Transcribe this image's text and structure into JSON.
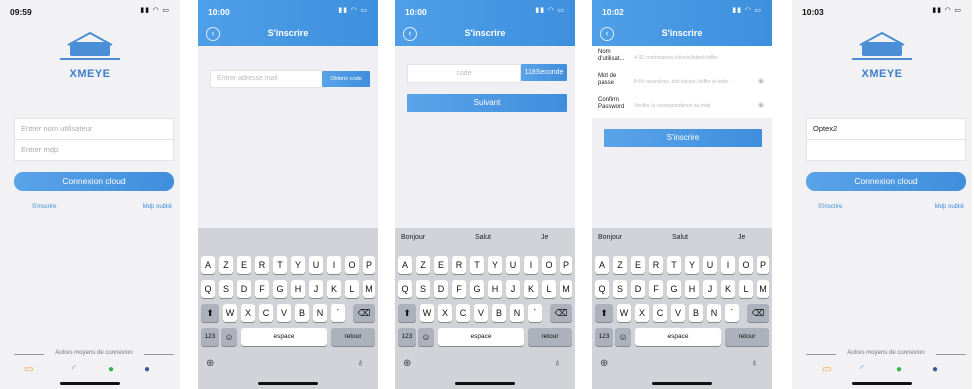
{
  "login": {
    "time": "09:59",
    "logo_text": "XMEYE",
    "username_placeholder": "Entrer nom utilisateur",
    "password_placeholder": "Entrer mdp",
    "cloud_button": "Connexion cloud",
    "register_link": "S'inscrire",
    "forgot_link": "Mdp oublié",
    "other_methods": "Autres moyens de connexion"
  },
  "email": {
    "time": "10:00",
    "title": "S'inscrire",
    "email_placeholder": "Entrer adresse mail",
    "code_button": "Obtenir code"
  },
  "code": {
    "time": "10:00",
    "title": "S'inscrire",
    "code_placeholder": "code",
    "countdown": "118Seconde",
    "next_button": "Suivant"
  },
  "register": {
    "time": "10:02",
    "title": "S'inscrire",
    "rows": [
      {
        "label": "Nom d'utilisat...",
        "placeholder": "4-32 combinaison chinois/lettre/chiffre"
      },
      {
        "label": "Mot de passe",
        "placeholder": "8-64 caractères, doit inclure chiffre et lettre"
      },
      {
        "label": "Confirm Password",
        "placeholder": "Vérifier la correspondance du mdp"
      }
    ],
    "submit_button": "S'inscrire"
  },
  "filled": {
    "time": "10:03",
    "logo_text": "XMEYE",
    "username_value": "Optex2",
    "cloud_button": "Connexion cloud",
    "register_link": "S'inscrire",
    "forgot_link": "Mdp oublié",
    "other_methods": "Autres moyens de connexion"
  },
  "keyboard": {
    "suggestions": [
      "Bonjour",
      "Salut",
      "Je"
    ],
    "row1": [
      "A",
      "Z",
      "E",
      "R",
      "T",
      "Y",
      "U",
      "I",
      "O",
      "P"
    ],
    "row2": [
      "Q",
      "S",
      "D",
      "F",
      "G",
      "H",
      "J",
      "K",
      "L",
      "M"
    ],
    "row3": [
      "W",
      "X",
      "C",
      "V",
      "B",
      "N",
      "´"
    ],
    "num_key": "123",
    "space_key": "espace",
    "return_key": "retour"
  }
}
